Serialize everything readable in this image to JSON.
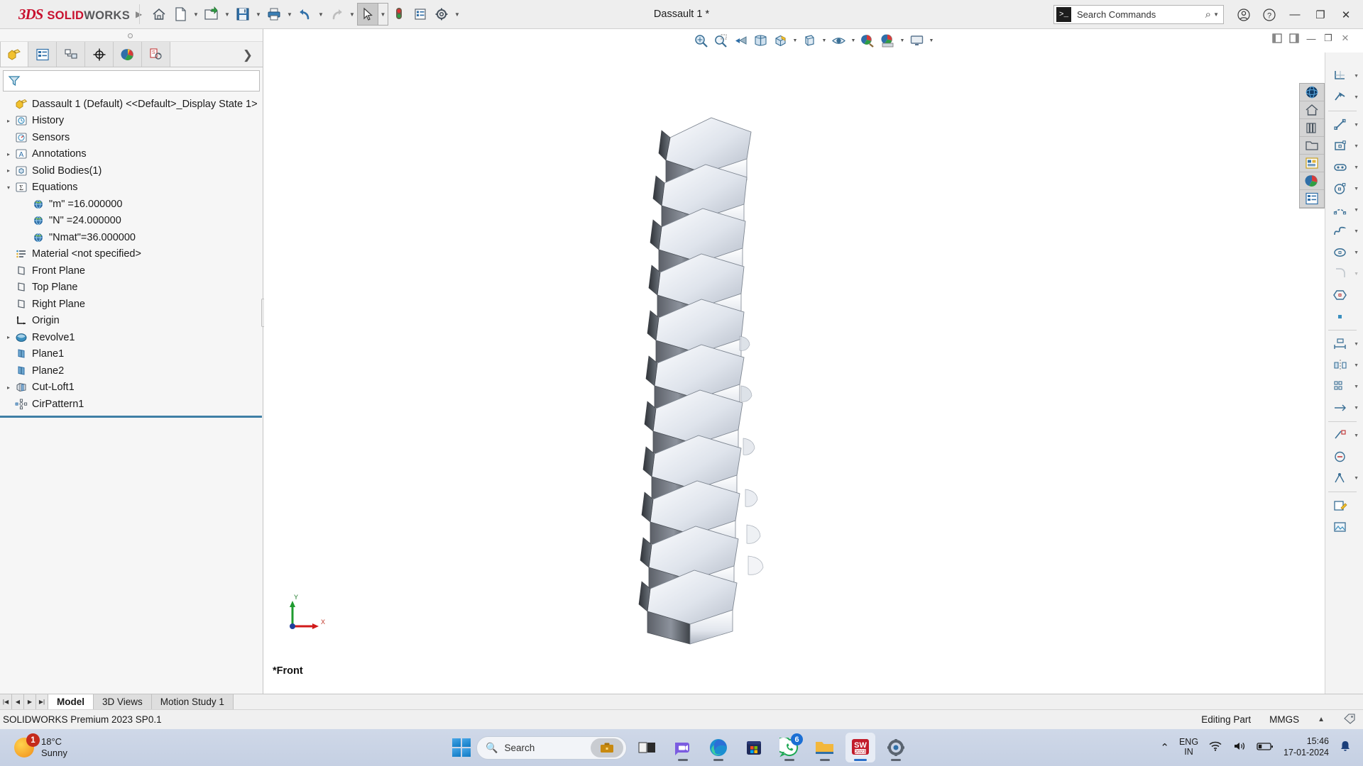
{
  "titlebar": {
    "brand_ds": "3DS",
    "brand_solid": "SOLID",
    "brand_works": "WORKS",
    "document_title": "Dassault 1 *",
    "buttons": [
      {
        "name": "home-button",
        "icon": "home-icon"
      },
      {
        "name": "new-document-button",
        "icon": "new-document-icon"
      },
      {
        "name": "open-document-button",
        "icon": "open-folder-icon"
      },
      {
        "name": "save-button",
        "icon": "save-floppy-icon"
      },
      {
        "name": "print-button",
        "icon": "printer-icon"
      },
      {
        "name": "undo-button",
        "icon": "undo-arrow-icon"
      },
      {
        "name": "redo-button",
        "icon": "redo-arrow-icon"
      },
      {
        "name": "select-button",
        "icon": "cursor-arrow-icon"
      },
      {
        "name": "rebuild-button",
        "icon": "traffic-light-icon"
      },
      {
        "name": "options-button",
        "icon": "options-list-icon"
      },
      {
        "name": "settings-button",
        "icon": "gear-icon"
      }
    ],
    "search": {
      "placeholder": "Search Commands",
      "prompt_glyph": ">_"
    },
    "window_controls": {
      "account": "account-icon",
      "help": "help-icon",
      "minimize": "—",
      "restore": "❐",
      "close": "✕"
    }
  },
  "feature_tree": {
    "tabs": [
      {
        "name": "tab-feature-manager",
        "icon": "feature-tree-icon"
      },
      {
        "name": "tab-property-manager",
        "icon": "property-manager-icon"
      },
      {
        "name": "tab-configuration-manager",
        "icon": "configuration-manager-icon"
      },
      {
        "name": "tab-dimxpert-manager",
        "icon": "dimxpert-icon"
      },
      {
        "name": "tab-display-manager",
        "icon": "display-manager-icon"
      },
      {
        "name": "tab-sw-cam",
        "icon": "cam-icon"
      }
    ],
    "expand_chevron": "❯",
    "filter_placeholder": "",
    "root": {
      "label": "Dassault 1 (Default) <<Default>_Display State 1>",
      "icon": "part-document-icon"
    },
    "items": [
      {
        "label": "History",
        "icon": "history-icon",
        "indent": 0,
        "twisty": "▸"
      },
      {
        "label": "Sensors",
        "icon": "sensors-icon",
        "indent": 0,
        "twisty": ""
      },
      {
        "label": "Annotations",
        "icon": "annotations-icon",
        "indent": 0,
        "twisty": "▸"
      },
      {
        "label": "Solid Bodies(1)",
        "icon": "solid-bodies-icon",
        "indent": 0,
        "twisty": "▸"
      },
      {
        "label": "Equations",
        "icon": "equations-icon",
        "indent": 0,
        "twisty": "▾"
      },
      {
        "label": "\"m\" =16.000000",
        "icon": "equation-global-variable-icon",
        "indent": 1,
        "twisty": ""
      },
      {
        "label": "\"N\" =24.000000",
        "icon": "equation-global-variable-icon",
        "indent": 1,
        "twisty": ""
      },
      {
        "label": "\"Nmat\"=36.000000",
        "icon": "equation-global-variable-icon",
        "indent": 1,
        "twisty": ""
      },
      {
        "label": "Material <not specified>",
        "icon": "material-icon",
        "indent": 0,
        "twisty": ""
      },
      {
        "label": "Front Plane",
        "icon": "plane-icon",
        "indent": 0,
        "twisty": ""
      },
      {
        "label": "Top Plane",
        "icon": "plane-icon",
        "indent": 0,
        "twisty": ""
      },
      {
        "label": "Right Plane",
        "icon": "plane-icon",
        "indent": 0,
        "twisty": ""
      },
      {
        "label": "Origin",
        "icon": "origin-icon",
        "indent": 0,
        "twisty": ""
      },
      {
        "label": "Revolve1",
        "icon": "revolve-icon",
        "indent": 0,
        "twisty": "▸"
      },
      {
        "label": "Plane1",
        "icon": "plane-blue-icon",
        "indent": 0,
        "twisty": ""
      },
      {
        "label": "Plane2",
        "icon": "plane-blue-icon",
        "indent": 0,
        "twisty": ""
      },
      {
        "label": "Cut-Loft1",
        "icon": "cut-loft-icon",
        "indent": 0,
        "twisty": "▸"
      },
      {
        "label": "CirPattern1",
        "icon": "circular-pattern-icon",
        "indent": 0,
        "twisty": ""
      }
    ]
  },
  "view_toolbar": {
    "buttons": [
      {
        "name": "zoom-to-fit-button",
        "icon": "zoom-fit-icon",
        "caret": false
      },
      {
        "name": "zoom-to-area-button",
        "icon": "zoom-area-icon",
        "caret": false
      },
      {
        "name": "previous-view-button",
        "icon": "previous-view-icon",
        "caret": false
      },
      {
        "name": "section-view-button",
        "icon": "section-view-icon",
        "caret": false
      },
      {
        "name": "view-orientation-button",
        "icon": "view-orientation-icon",
        "caret": true
      },
      {
        "name": "display-style-button",
        "icon": "display-style-icon",
        "caret": true
      },
      {
        "name": "hide-show-items-button",
        "icon": "hide-show-icon",
        "caret": true
      },
      {
        "name": "edit-appearance-button",
        "icon": "appearance-icon",
        "caret": true
      },
      {
        "name": "apply-scene-button",
        "icon": "scene-icon",
        "caret": true
      },
      {
        "name": "view-settings-button",
        "icon": "display-monitor-icon",
        "caret": true
      }
    ],
    "window_controls": [
      "restore-down-icon",
      "maximize-icon",
      "minimize-icon",
      "restore-icon",
      "close-icon"
    ]
  },
  "task_pane": {
    "buttons": [
      {
        "name": "3d-experience-button",
        "icon": "3dexperience-globe-icon"
      },
      {
        "name": "sw-resources-button",
        "icon": "home-resources-icon"
      },
      {
        "name": "design-library-button",
        "icon": "design-library-icon"
      },
      {
        "name": "file-explorer-button",
        "icon": "file-explorer-folder-icon"
      },
      {
        "name": "view-palette-button",
        "icon": "view-palette-icon"
      },
      {
        "name": "appearances-scenes-button",
        "icon": "appearances-sphere-icon"
      },
      {
        "name": "custom-properties-button",
        "icon": "custom-properties-icon"
      }
    ]
  },
  "sketch_toolbar": {
    "buttons": [
      {
        "name": "trim-entities-button",
        "icon": "trim-entities-icon",
        "caret": true
      },
      {
        "name": "convert-entities-button",
        "icon": "convert-entities-icon",
        "caret": true
      },
      {
        "name": "line-button",
        "icon": "line-icon",
        "caret": true
      },
      {
        "name": "rectangle-button",
        "icon": "rectangle-icon",
        "caret": true
      },
      {
        "name": "slot-button",
        "icon": "slot-icon",
        "caret": true
      },
      {
        "name": "circle-button",
        "icon": "circle-icon",
        "caret": true
      },
      {
        "name": "arc-button",
        "icon": "arc-icon",
        "caret": true
      },
      {
        "name": "spline-button",
        "icon": "spline-icon",
        "caret": true
      },
      {
        "name": "ellipse-button",
        "icon": "ellipse-icon",
        "caret": true
      },
      {
        "name": "fillet-button",
        "icon": "sketch-fillet-icon",
        "caret": true
      },
      {
        "name": "polygon-button",
        "icon": "polygon-icon",
        "caret": false
      },
      {
        "name": "point-button",
        "icon": "point-icon",
        "caret": false
      }
    ]
  },
  "graphics_area": {
    "view_label": "*Front",
    "triad": {
      "x_label": "X",
      "y_label": "Y"
    },
    "model_name": "gear-stack-model"
  },
  "bottom_tabs": {
    "nav": [
      "|◀",
      "◀",
      "▶",
      "▶|"
    ],
    "tabs": [
      {
        "label": "Model",
        "active": true
      },
      {
        "label": "3D Views",
        "active": false
      },
      {
        "label": "Motion Study 1",
        "active": false
      }
    ]
  },
  "status_bar": {
    "version": "SOLIDWORKS Premium 2023 SP0.1",
    "editing_state": "Editing Part",
    "units": "MMGS",
    "units_caret": "▲",
    "tag_icon": "tag-icon"
  },
  "taskbar": {
    "weather": {
      "temperature": "18°C",
      "condition": "Sunny",
      "badge": "1"
    },
    "search": {
      "placeholder": "Search",
      "icon": "search-icon"
    },
    "apps": [
      {
        "name": "taskbar-task-view",
        "icon": "task-view-icon",
        "active": false,
        "badge": ""
      },
      {
        "name": "taskbar-teams",
        "icon": "teams-icon",
        "active": false,
        "badge": ""
      },
      {
        "name": "taskbar-edge",
        "icon": "edge-icon",
        "active": false,
        "badge": ""
      },
      {
        "name": "taskbar-microsoft-store",
        "icon": "store-icon",
        "active": false,
        "badge": ""
      },
      {
        "name": "taskbar-whatsapp",
        "icon": "whatsapp-icon",
        "active": false,
        "badge": "6"
      },
      {
        "name": "taskbar-file-explorer",
        "icon": "folder-icon",
        "active": false,
        "badge": ""
      },
      {
        "name": "taskbar-solidworks",
        "icon": "solidworks-2023-icon",
        "active": true,
        "badge": ""
      },
      {
        "name": "taskbar-settings",
        "icon": "settings-gear-icon",
        "active": false,
        "badge": ""
      }
    ],
    "tray": {
      "chevron": "⌃",
      "language_line1": "ENG",
      "language_line2": "IN",
      "wifi": "wifi-icon",
      "volume": "volume-icon",
      "battery": "battery-icon",
      "time": "15:46",
      "date": "17-01-2024",
      "notification": "bell-icon"
    }
  },
  "colors": {
    "brand_red": "#c8102e",
    "accent_blue": "#3f7fa6",
    "taskbar_bg": "#cfd8e8"
  }
}
